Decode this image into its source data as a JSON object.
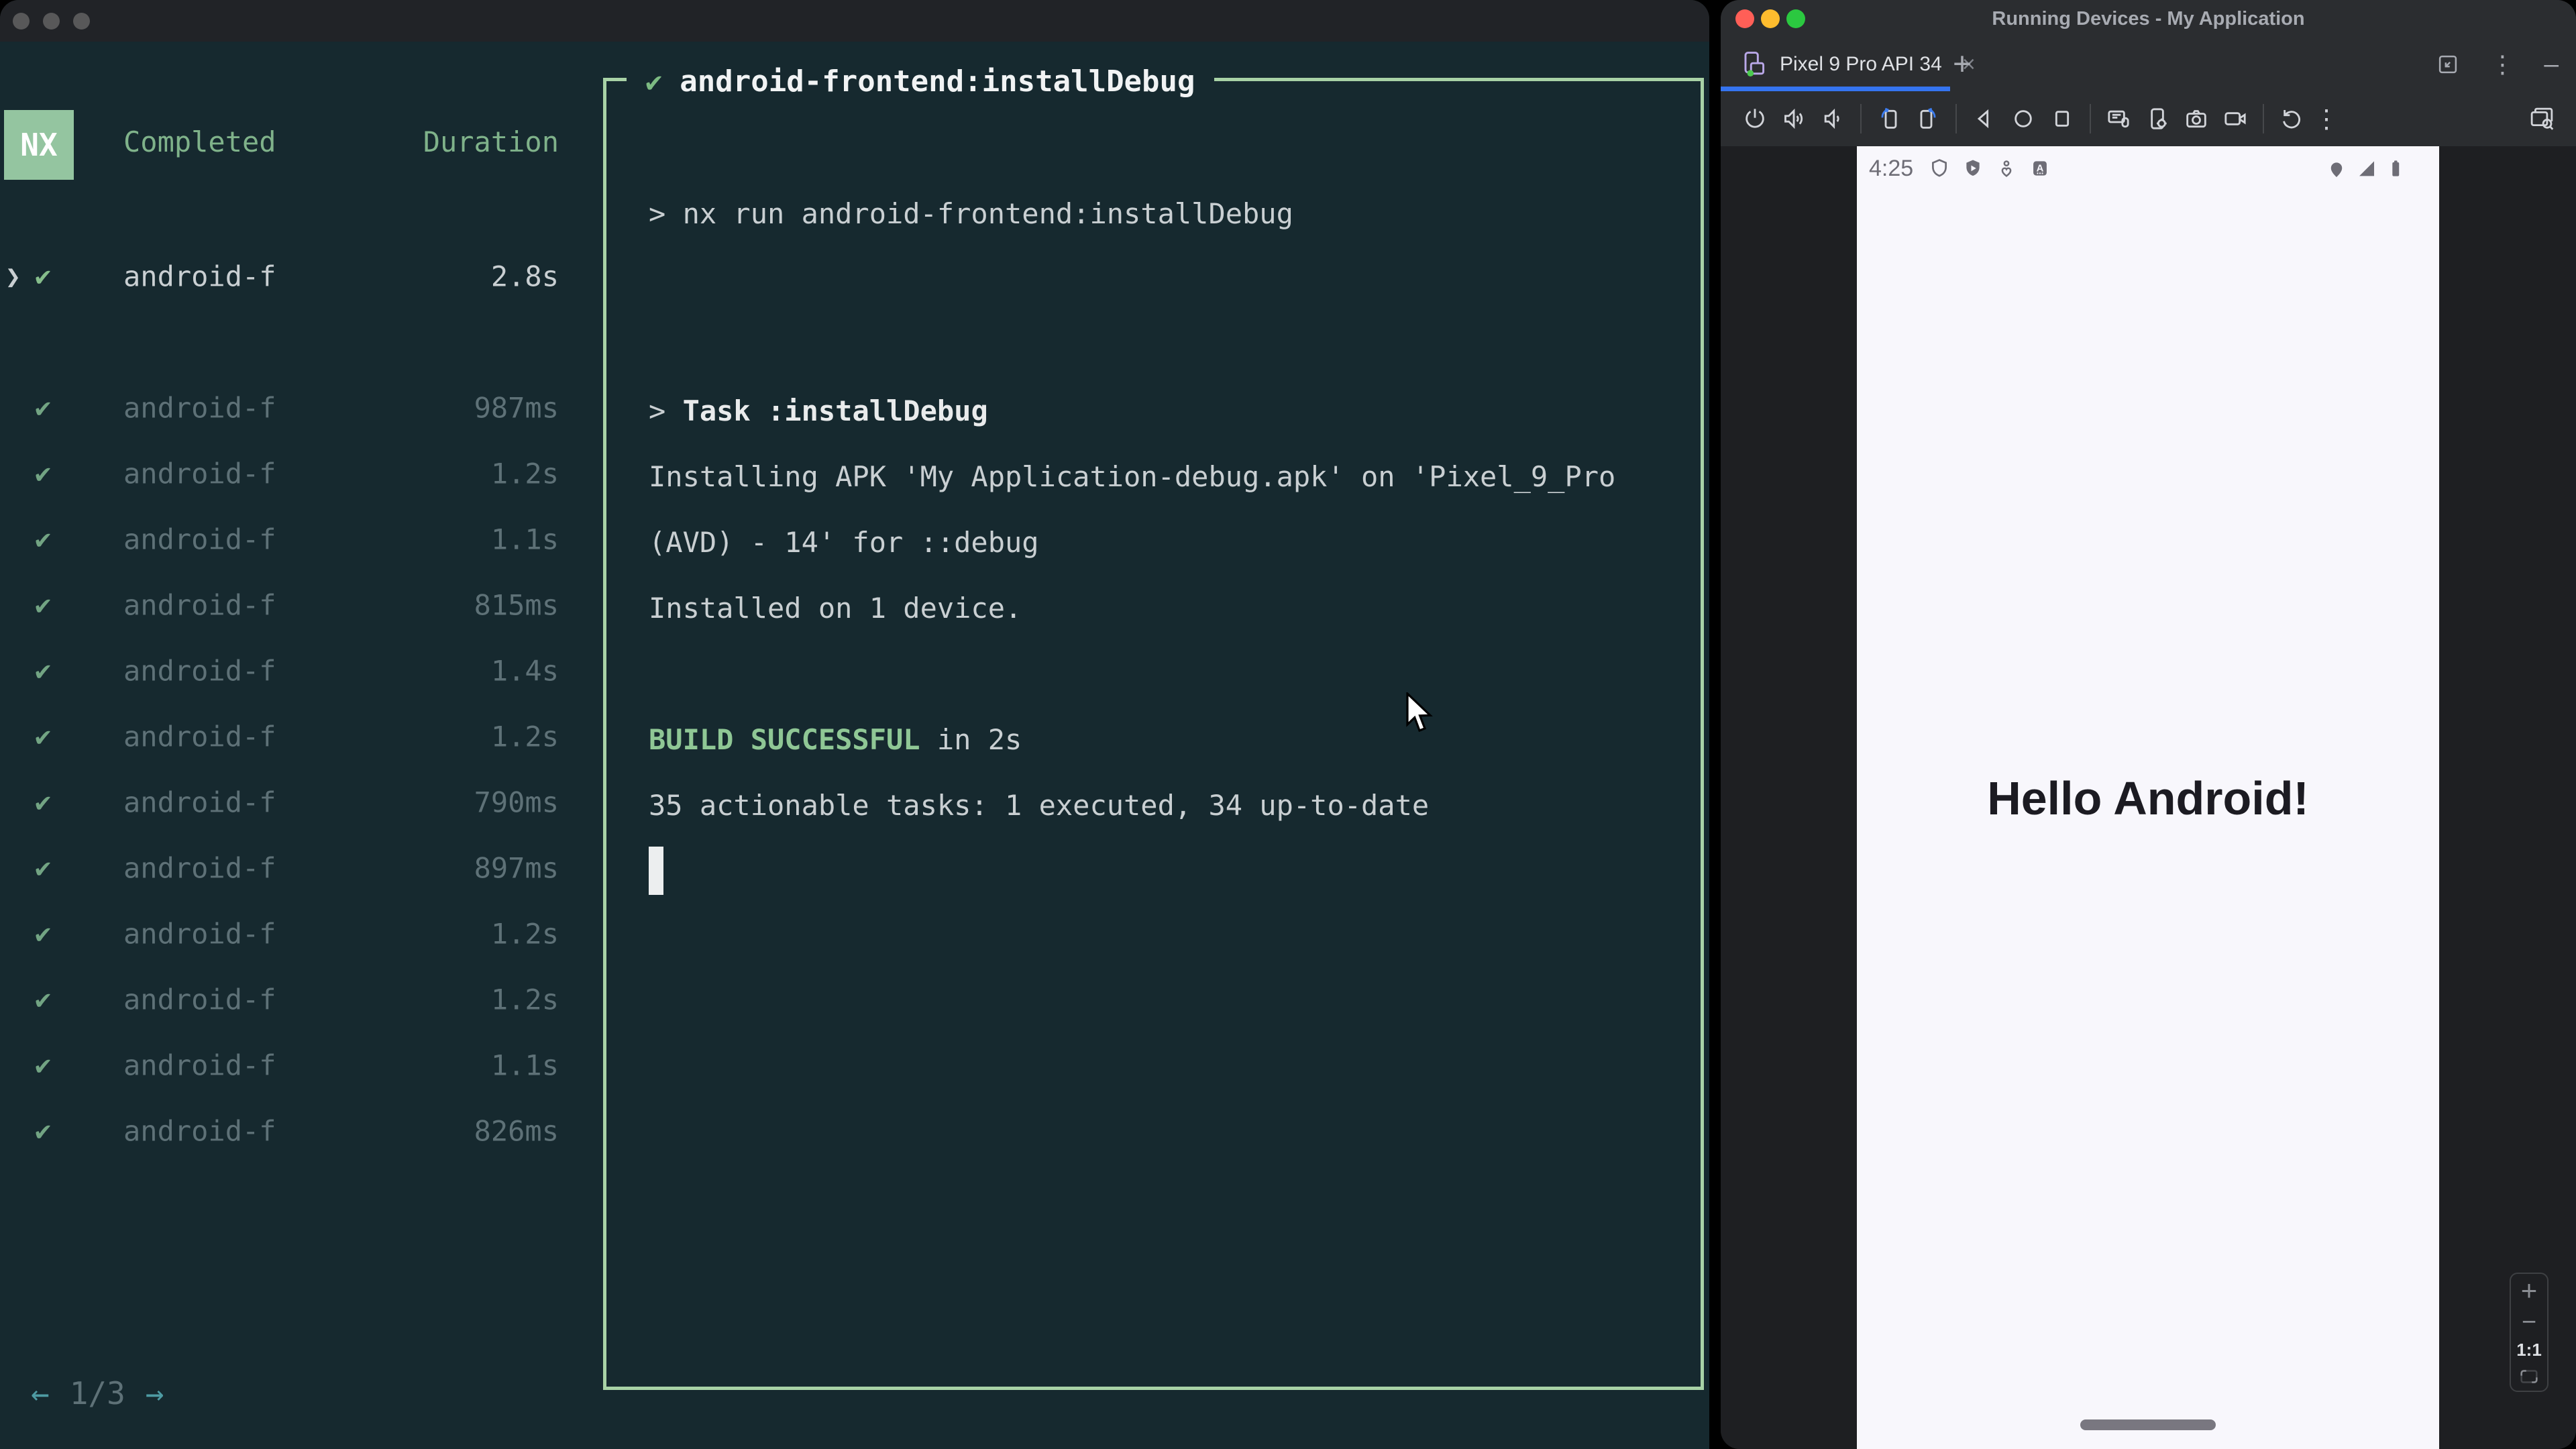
{
  "icons": {
    "check": "✔",
    "chevron": "❯",
    "prompt": ">",
    "left_arrow": "←",
    "right_arrow": "→",
    "close": "×",
    "plus": "+",
    "kebab": "⋮",
    "minimize": "—",
    "zoom_in": "+",
    "zoom_out": "−"
  },
  "left_window": {
    "sidebar": {
      "logo_text": "NX",
      "col_completed": "Completed",
      "col_duration": "Duration",
      "rows": [
        {
          "name": "android-f",
          "duration": "2.8s",
          "selected": true
        },
        {
          "name": "android-f",
          "duration": "987ms"
        },
        {
          "name": "android-f",
          "duration": "1.2s"
        },
        {
          "name": "android-f",
          "duration": "1.1s"
        },
        {
          "name": "android-f",
          "duration": "815ms"
        },
        {
          "name": "android-f",
          "duration": "1.4s"
        },
        {
          "name": "android-f",
          "duration": "1.2s"
        },
        {
          "name": "android-f",
          "duration": "790ms"
        },
        {
          "name": "android-f",
          "duration": "897ms"
        },
        {
          "name": "android-f",
          "duration": "1.2s"
        },
        {
          "name": "android-f",
          "duration": "1.2s"
        },
        {
          "name": "android-f",
          "duration": "1.1s"
        },
        {
          "name": "android-f",
          "duration": "826ms"
        }
      ],
      "pagination": {
        "page": "1/3"
      }
    },
    "terminal": {
      "header_title": "android-frontend:installDebug",
      "lines": [
        {
          "segs": [
            {
              "t": "> nx run android-frontend:installDebug"
            }
          ]
        },
        {
          "segs": []
        },
        {
          "segs": []
        },
        {
          "segs": [
            {
              "t": "> "
            },
            {
              "t": "Task :installDebug",
              "b": true
            }
          ]
        },
        {
          "segs": [
            {
              "t": "Installing APK 'My Application-debug.apk' on 'Pixel_9_Pro"
            }
          ]
        },
        {
          "segs": [
            {
              "t": "(AVD) - 14' for ::debug"
            }
          ]
        },
        {
          "segs": [
            {
              "t": "Installed on 1 device."
            }
          ]
        },
        {
          "segs": []
        },
        {
          "segs": [
            {
              "t": "BUILD SUCCESSFUL",
              "g": true
            },
            {
              "t": " in 2s"
            }
          ]
        },
        {
          "segs": [
            {
              "t": "35 actionable tasks: 1 executed, 34 up-to-date"
            }
          ]
        },
        {
          "cursor": true,
          "segs": []
        }
      ]
    }
  },
  "right_window": {
    "title": "Running Devices - My Application",
    "tab": {
      "label": "Pixel 9 Pro API 34"
    },
    "device": {
      "status_time": "4:25",
      "hello_text": "Hello Android!",
      "zoom_label": "1:1"
    }
  },
  "colors": {
    "terminal_bg": "#16292F",
    "panel_border_green": "#A8D2A6",
    "success_green": "#8FC795",
    "nx_badge_green": "#94C5A0",
    "accent_blue": "#3574F0",
    "ide_bg": "#2B2D30",
    "device_bg": "#1E1F22",
    "screen_bg": "#F8F7FC"
  }
}
